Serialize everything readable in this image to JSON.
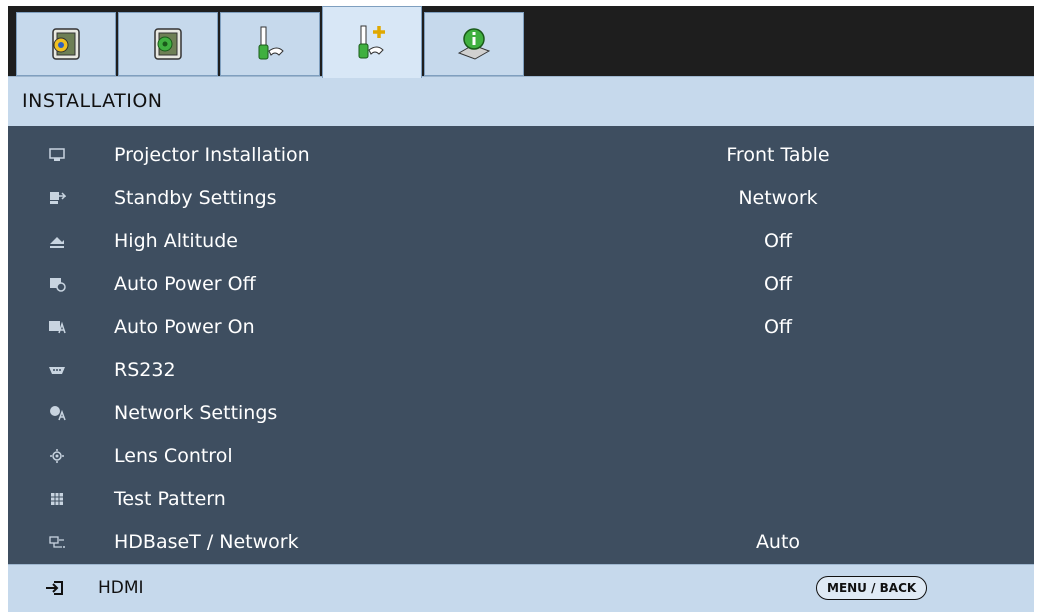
{
  "tabs": [
    {
      "name": "image-tab",
      "icon": "image-settings-icon",
      "active": false
    },
    {
      "name": "display-tab",
      "icon": "display-settings-icon",
      "active": false
    },
    {
      "name": "setup-tab",
      "icon": "setup-tools-icon",
      "active": false
    },
    {
      "name": "installation-tab",
      "icon": "installation-tools-icon",
      "active": true
    },
    {
      "name": "information-tab",
      "icon": "information-icon",
      "active": false
    }
  ],
  "header": {
    "title": "INSTALLATION"
  },
  "menu": {
    "items": [
      {
        "icon": "projector-icon",
        "label": "Projector Installation",
        "value": "Front Table"
      },
      {
        "icon": "standby-icon",
        "label": "Standby Settings",
        "value": "Network"
      },
      {
        "icon": "altitude-icon",
        "label": "High Altitude",
        "value": "Off"
      },
      {
        "icon": "auto-power-off-icon",
        "label": "Auto Power Off",
        "value": "Off"
      },
      {
        "icon": "auto-power-on-icon",
        "label": "Auto Power On",
        "value": "Off"
      },
      {
        "icon": "rs232-icon",
        "label": "RS232",
        "value": ""
      },
      {
        "icon": "network-icon",
        "label": "Network Settings",
        "value": ""
      },
      {
        "icon": "lens-icon",
        "label": "Lens Control",
        "value": ""
      },
      {
        "icon": "test-pattern-icon",
        "label": "Test Pattern",
        "value": ""
      },
      {
        "icon": "hdbaset-icon",
        "label": "HDBaseT / Network",
        "value": "Auto"
      }
    ]
  },
  "footer": {
    "source_icon": "input-source-icon",
    "source": "HDMI",
    "back_label": "MENU / BACK"
  },
  "colors": {
    "tab_bar": "#1e1e1e",
    "tab": "#c6d9ec",
    "menu_bg": "#3e4e60",
    "text_on_menu": "#ffffff"
  }
}
